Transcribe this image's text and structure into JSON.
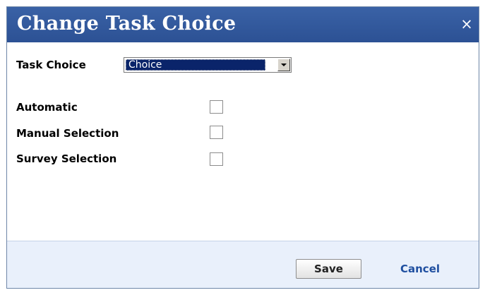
{
  "dialog": {
    "title": "Change Task Choice",
    "close_glyph": "×",
    "close_icon": "close-icon"
  },
  "task_choice": {
    "label": "Task Choice",
    "selected_value": "Choice",
    "dropdown_icon": "chevron-down-icon"
  },
  "options": [
    {
      "label": "Automatic",
      "checked": false
    },
    {
      "label": "Manual Selection",
      "checked": false
    },
    {
      "label": "Survey Selection",
      "checked": false
    }
  ],
  "footer": {
    "save_label": "Save",
    "cancel_label": "Cancel"
  },
  "colors": {
    "titlebar": "#2f5597",
    "footer_background": "#e9f0fb",
    "link": "#1f4fa0",
    "selection_highlight": "#0a246a"
  }
}
